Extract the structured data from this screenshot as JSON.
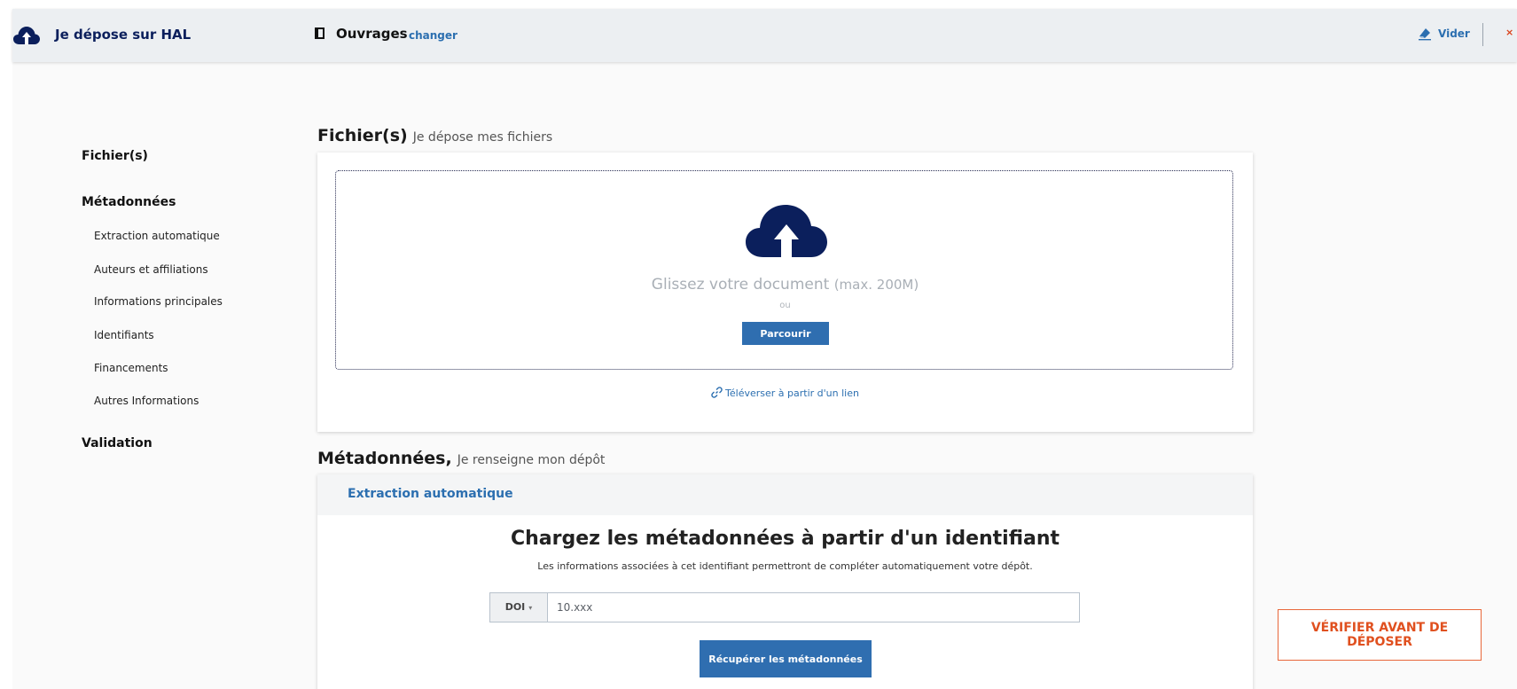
{
  "header": {
    "brand": "Je dépose sur HAL",
    "doc_type": "Ouvrages",
    "change_label": "changer",
    "clear_label": "Vider",
    "close_label": "×"
  },
  "sidebar": {
    "items": [
      {
        "label": "Fichier(s)",
        "level": 1
      },
      {
        "label": "Métadonnées",
        "level": 1
      },
      {
        "label": "Extraction automatique",
        "level": 2
      },
      {
        "label": "Auteurs et affiliations",
        "level": 2
      },
      {
        "label": "Informations principales",
        "level": 2
      },
      {
        "label": "Identifiants",
        "level": 2
      },
      {
        "label": "Financements",
        "level": 2
      },
      {
        "label": "Autres Informations",
        "level": 2
      },
      {
        "label": "Validation",
        "level": 1
      }
    ]
  },
  "files_section": {
    "title": "Fichier(s)",
    "subtitle": "Je dépose mes fichiers",
    "drop_text": "Glissez votre document",
    "drop_limit": "(max. 200M)",
    "or_text": "ou",
    "browse_label": "Parcourir",
    "link_label": "Téléverser à partir d'un lien"
  },
  "metadata_section": {
    "title": "Métadonnées,",
    "subtitle": "Je renseigne mon dépôt",
    "panel_label": "Extraction automatique",
    "heading": "Chargez les métadonnées à partir d'un identifiant",
    "description": "Les informations associées à cet identifiant permettront de compléter automatiquement votre dépôt.",
    "id_type": "DOI",
    "id_placeholder": "10.xxx",
    "id_value": "",
    "fetch_label": "Récupérer les métadonnées"
  },
  "verify_label": "VÉRIFIER AVANT DE DÉPOSER",
  "colors": {
    "accent": "#2f6eb0",
    "brand_navy": "#0b1f5c",
    "warning": "#e0501f"
  },
  "icons": {
    "brand": "cloud-upload-icon",
    "doc_type": "book-icon",
    "clear": "eraser-icon",
    "upload": "cloud-upload-icon",
    "link": "link-icon"
  }
}
